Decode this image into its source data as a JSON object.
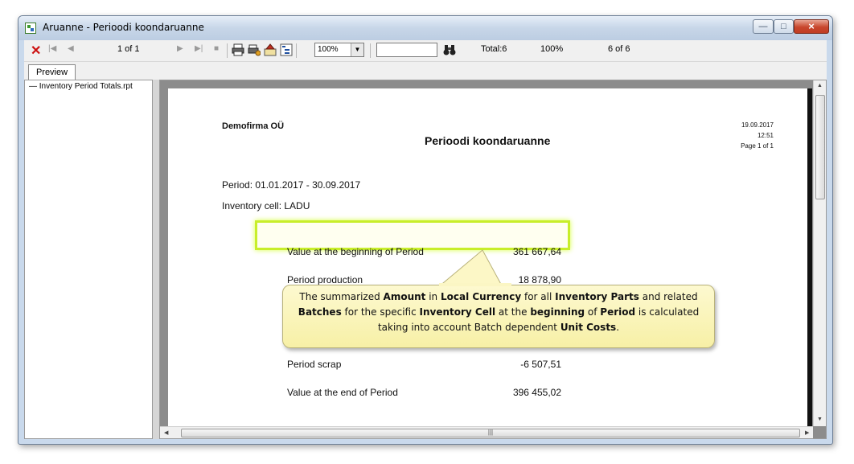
{
  "window": {
    "title": "Aruanne - Perioodi koondaruanne"
  },
  "toolbar": {
    "page_indicator": "1 of 1",
    "zoom": "100%",
    "search_value": "",
    "total": "Total:6",
    "percent": "100%",
    "records": "6 of 6"
  },
  "tabs": {
    "preview": "Preview"
  },
  "tree": {
    "items": [
      "Inventory Period Totals.rpt"
    ]
  },
  "report": {
    "company": "Demofirma OÜ",
    "title": "Perioodi koondaruanne",
    "date": "19.09.2017",
    "time": "12:51",
    "page": "Page 1 of 1",
    "period": "Period: 01.01.2017 - 30.09.2017",
    "inventory_cell": "Inventory cell: LADU",
    "rows": [
      {
        "label": "Value at the beginning of Period",
        "value": "361 667,64"
      },
      {
        "label": "Period production",
        "value": "18 878,90"
      },
      {
        "label": "Period scrap",
        "value": "-6 507,51"
      },
      {
        "label": "Value at the end of Period",
        "value": "396 455,02"
      }
    ]
  },
  "callout": {
    "segments": [
      {
        "text": "The summarized ",
        "bold": false
      },
      {
        "text": "Amount",
        "bold": true
      },
      {
        "text": " in ",
        "bold": false
      },
      {
        "text": "Local Currency",
        "bold": true
      },
      {
        "text": " for all ",
        "bold": false
      },
      {
        "text": "Inventory Parts",
        "bold": true
      },
      {
        "text": " and related ",
        "bold": false
      },
      {
        "text": "Batches",
        "bold": true
      },
      {
        "text": " for the specific ",
        "bold": false
      },
      {
        "text": "Inventory Cell",
        "bold": true
      },
      {
        "text": " at the ",
        "bold": false
      },
      {
        "text": "beginning",
        "bold": true
      },
      {
        "text": " of ",
        "bold": false
      },
      {
        "text": "Period",
        "bold": true
      },
      {
        "text": " is calculated taking into account Batch dependent ",
        "bold": false
      },
      {
        "text": "Unit Costs",
        "bold": true
      },
      {
        "text": ".",
        "bold": false
      }
    ]
  },
  "colors": {
    "highlight": "#c8ee2a",
    "callout_bg": "#f7f0a6",
    "close_icon": "#cc1010"
  }
}
